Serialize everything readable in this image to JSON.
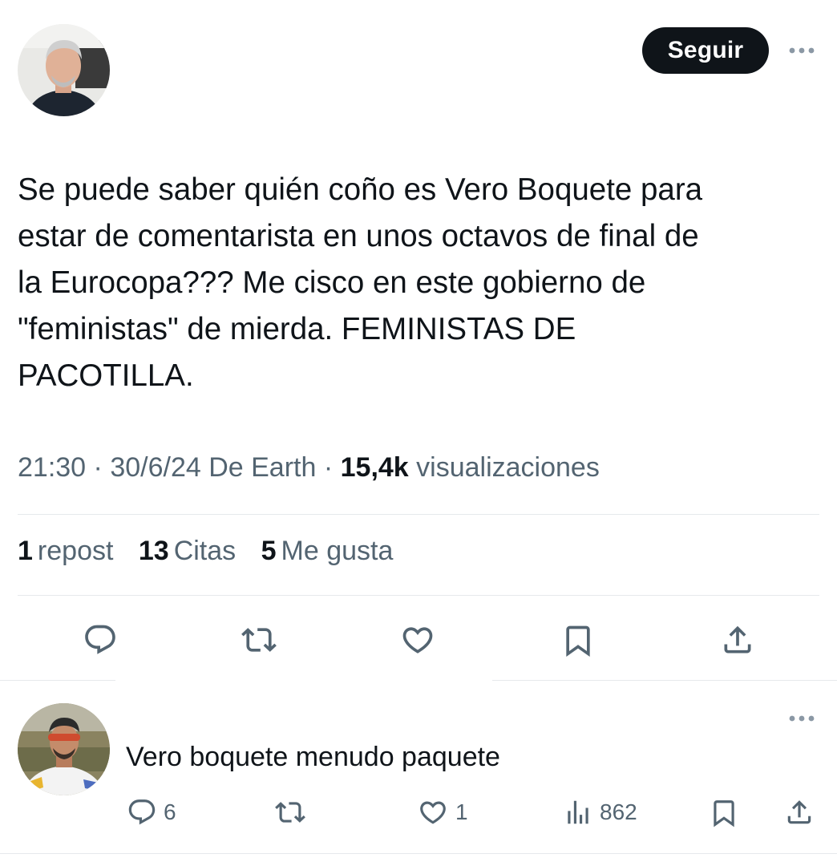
{
  "tweet": {
    "follow_label": "Seguir",
    "text": "Se puede saber quién coño es Vero Boquete para\nestar de comentarista en unos octavos de final de\nla Eurocopa??? Me cisco en este gobierno de\n\"feministas\" de mierda. FEMINISTAS DE\nPACOTILLA.",
    "time": "21:30",
    "sep": "·",
    "date_source": "30/6/24 De Earth",
    "views_count": "15,4k",
    "views_label": "visualizaciones",
    "reposts_count": "1",
    "reposts_label": "repost",
    "quotes_count": "13",
    "quotes_label": "Citas",
    "likes_count": "5",
    "likes_label": "Me gusta"
  },
  "reply": {
    "text": "Vero boquete menudo paquete",
    "replies": "6",
    "likes": "1",
    "views": "862"
  },
  "icons": [
    "more-icon",
    "reply-icon",
    "repost-icon",
    "like-icon",
    "bookmark-icon",
    "share-icon",
    "views-icon"
  ],
  "colors": {
    "follow_bg": "#0f1419",
    "text": "#0f1419",
    "muted": "#536471",
    "divider": "#e6e9ec"
  }
}
